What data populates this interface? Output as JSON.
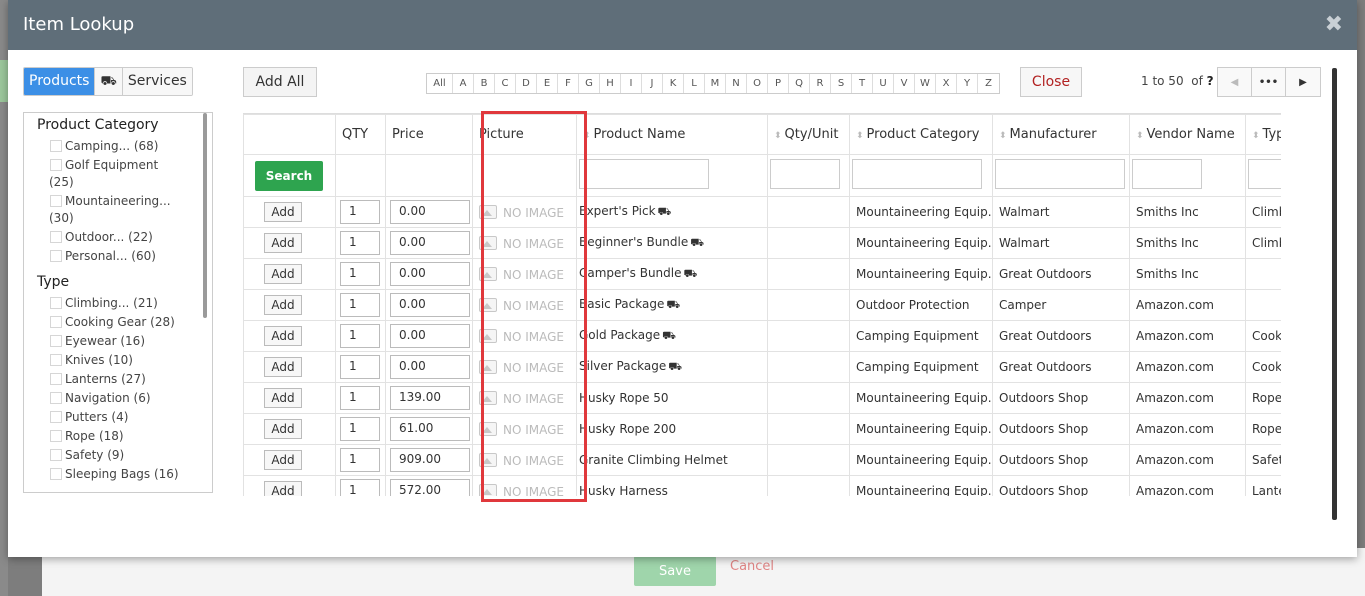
{
  "background": {
    "save_label": "Save",
    "cancel_label": "Cancel"
  },
  "modal": {
    "title": "Item Lookup",
    "close_glyph": "✖"
  },
  "tabs": {
    "products": "Products",
    "bundle_icon": "⛟",
    "services": "Services"
  },
  "filters": {
    "category_heading": "Product Category",
    "categories": [
      {
        "label": "Camping... (68)"
      },
      {
        "label": "Golf Equipment",
        "extra": "(25)"
      },
      {
        "label": "Mountaineering...",
        "extra": "(30)"
      },
      {
        "label": "Outdoor... (22)"
      },
      {
        "label": "Personal... (60)"
      }
    ],
    "type_heading": "Type",
    "types": [
      {
        "label": "Climbing... (21)"
      },
      {
        "label": "Cooking Gear (28)"
      },
      {
        "label": "Eyewear (16)"
      },
      {
        "label": "Knives (10)"
      },
      {
        "label": "Lanterns (27)"
      },
      {
        "label": "Navigation (6)"
      },
      {
        "label": "Putters (4)"
      },
      {
        "label": "Rope (18)"
      },
      {
        "label": "Safety (9)"
      },
      {
        "label": "Sleeping Bags (16)"
      }
    ]
  },
  "toolbar": {
    "add_all": "Add All",
    "letters": [
      "All",
      "A",
      "B",
      "C",
      "D",
      "E",
      "F",
      "G",
      "H",
      "I",
      "J",
      "K",
      "L",
      "M",
      "N",
      "O",
      "P",
      "Q",
      "R",
      "S",
      "T",
      "U",
      "V",
      "W",
      "X",
      "Y",
      "Z"
    ],
    "close": "Close",
    "paging_range": "1 to 50",
    "paging_of": "of",
    "paging_total": "?",
    "pager_prev": "◀",
    "pager_dots": "•••",
    "pager_next": "▶"
  },
  "grid": {
    "headers": [
      "",
      "QTY",
      "Price",
      "Picture",
      "Product Name",
      "Qty/Unit",
      "Product Category",
      "Manufacturer",
      "Vendor Name",
      "Typ"
    ],
    "search_label": "Search",
    "add_label": "Add",
    "no_image": "NO IMAGE",
    "rows": [
      {
        "qty": "1",
        "price": "0.00",
        "name": "Expert's Pick",
        "bundle": true,
        "unit": "",
        "category": "Mountaineering Equip.",
        "manufacturer": "Walmart",
        "vendor": "Smiths Inc",
        "type": "Climb"
      },
      {
        "qty": "1",
        "price": "0.00",
        "name": "Beginner's Bundle",
        "bundle": true,
        "unit": "",
        "category": "Mountaineering Equip.",
        "manufacturer": "Walmart",
        "vendor": "Smiths Inc",
        "type": "Climb"
      },
      {
        "qty": "1",
        "price": "0.00",
        "name": "Camper's Bundle",
        "bundle": true,
        "unit": "",
        "category": "Mountaineering Equip.",
        "manufacturer": "Great Outdoors",
        "vendor": "Smiths Inc",
        "type": ""
      },
      {
        "qty": "1",
        "price": "0.00",
        "name": "Basic Package",
        "bundle": true,
        "unit": "",
        "category": "Outdoor Protection",
        "manufacturer": "Camper",
        "vendor": "Amazon.com",
        "type": ""
      },
      {
        "qty": "1",
        "price": "0.00",
        "name": "Gold Package",
        "bundle": true,
        "unit": "",
        "category": "Camping Equipment",
        "manufacturer": "Great Outdoors",
        "vendor": "Amazon.com",
        "type": "Cook"
      },
      {
        "qty": "1",
        "price": "0.00",
        "name": "Silver Package",
        "bundle": true,
        "unit": "",
        "category": "Camping Equipment",
        "manufacturer": "Great Outdoors",
        "vendor": "Amazon.com",
        "type": "Cook"
      },
      {
        "qty": "1",
        "price": "139.00",
        "name": "Husky Rope 50",
        "bundle": false,
        "unit": "",
        "category": "Mountaineering Equip.",
        "manufacturer": "Outdoors Shop",
        "vendor": "Amazon.com",
        "type": "Rope"
      },
      {
        "qty": "1",
        "price": "61.00",
        "name": "Husky Rope 200",
        "bundle": false,
        "unit": "",
        "category": "Mountaineering Equip.",
        "manufacturer": "Outdoors Shop",
        "vendor": "Amazon.com",
        "type": "Rope"
      },
      {
        "qty": "1",
        "price": "909.00",
        "name": "Granite Climbing Helmet",
        "bundle": false,
        "unit": "",
        "category": "Mountaineering Equip.",
        "manufacturer": "Outdoors Shop",
        "vendor": "Amazon.com",
        "type": "Safet"
      },
      {
        "qty": "1",
        "price": "572.00",
        "name": "Husky Harness",
        "bundle": false,
        "unit": "",
        "category": "Mountaineering Equip.",
        "manufacturer": "Outdoors Shop",
        "vendor": "Amazon.com",
        "type": "Lante"
      }
    ]
  }
}
